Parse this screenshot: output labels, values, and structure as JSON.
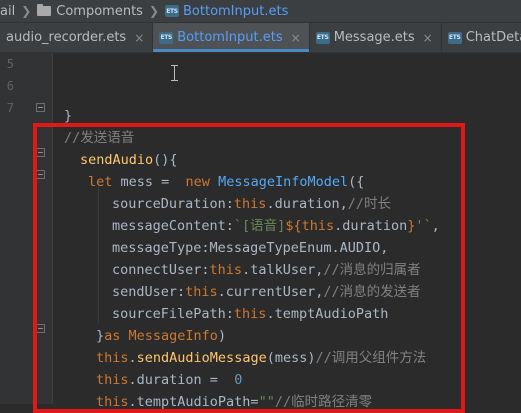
{
  "breadcrumb": {
    "items": [
      {
        "label": "ail",
        "kind": "folder",
        "active": false
      },
      {
        "label": "Compoments",
        "kind": "folder",
        "active": false
      },
      {
        "label": "BottomInput.ets",
        "kind": "ets-file",
        "active": true
      }
    ]
  },
  "tabs": [
    {
      "label": "audio_recorder.ets",
      "icon": "none",
      "active": false
    },
    {
      "label": "BottomInput.ets",
      "icon": "ets-file-icon",
      "active": true
    },
    {
      "label": "Message.ets",
      "icon": "ets-file-icon",
      "active": false
    },
    {
      "label": "ChatDetail.ets",
      "icon": "ets-file-icon",
      "active": false
    }
  ],
  "tab_close_glyph": "×",
  "ets_icon_text": "ETS",
  "gutter": {
    "line_numbers": [
      "5",
      "6",
      "7"
    ]
  },
  "code_lines": [
    {
      "indent": 0,
      "tokens": []
    },
    {
      "indent": 0,
      "tokens": []
    },
    {
      "indent": 64,
      "tokens": [
        {
          "t": "}",
          "c": "plain"
        }
      ]
    },
    {
      "indent": 64,
      "tokens": [
        {
          "t": "//发送语音",
          "c": "cmt"
        }
      ]
    },
    {
      "indent": 80,
      "tokens": [
        {
          "t": "sendAudio",
          "c": "fn"
        },
        {
          "t": "(){",
          "c": "plain"
        }
      ]
    },
    {
      "indent": 88,
      "tokens": [
        {
          "t": "let ",
          "c": "kw"
        },
        {
          "t": "mess =  ",
          "c": "plain"
        },
        {
          "t": "new ",
          "c": "kw"
        },
        {
          "t": "MessageInfoModel",
          "c": "cls"
        },
        {
          "t": "({",
          "c": "plain"
        }
      ]
    },
    {
      "indent": 112,
      "tokens": [
        {
          "t": "sourceDuration:",
          "c": "plain"
        },
        {
          "t": "this",
          "c": "kw"
        },
        {
          "t": ".duration,",
          "c": "plain"
        },
        {
          "t": "//时长",
          "c": "cmt"
        }
      ]
    },
    {
      "indent": 112,
      "tokens": [
        {
          "t": "messageContent:",
          "c": "plain"
        },
        {
          "t": "`[语音]",
          "c": "str"
        },
        {
          "t": "${",
          "c": "kw"
        },
        {
          "t": "this",
          "c": "kw"
        },
        {
          "t": ".duration",
          "c": "plain"
        },
        {
          "t": "}",
          "c": "kw"
        },
        {
          "t": "'`",
          "c": "str"
        },
        {
          "t": ",",
          "c": "plain"
        }
      ]
    },
    {
      "indent": 112,
      "tokens": [
        {
          "t": "messageType:MessageTypeEnum.AUDIO,",
          "c": "plain"
        }
      ]
    },
    {
      "indent": 112,
      "tokens": [
        {
          "t": "connectUser:",
          "c": "plain"
        },
        {
          "t": "this",
          "c": "kw"
        },
        {
          "t": ".talkUser,",
          "c": "plain"
        },
        {
          "t": "//消息的归属者",
          "c": "cmt"
        }
      ]
    },
    {
      "indent": 112,
      "tokens": [
        {
          "t": "sendUser:",
          "c": "plain"
        },
        {
          "t": "this",
          "c": "kw"
        },
        {
          "t": ".currentUser,",
          "c": "plain"
        },
        {
          "t": "//消息的发送者",
          "c": "cmt"
        }
      ]
    },
    {
      "indent": 112,
      "tokens": [
        {
          "t": "sourceFilePath:",
          "c": "plain"
        },
        {
          "t": "this",
          "c": "kw"
        },
        {
          "t": ".temptAudioPath",
          "c": "plain"
        }
      ]
    },
    {
      "indent": 96,
      "tokens": [
        {
          "t": "}",
          "c": "plain"
        },
        {
          "t": "as ",
          "c": "kw"
        },
        {
          "t": "MessageInfo",
          "c": "kw"
        },
        {
          "t": ")",
          "c": "plain"
        }
      ]
    },
    {
      "indent": 96,
      "tokens": [
        {
          "t": "this",
          "c": "kw"
        },
        {
          "t": ".",
          "c": "plain"
        },
        {
          "t": "sendAudioMessage",
          "c": "fn"
        },
        {
          "t": "(mess)",
          "c": "plain"
        },
        {
          "t": "//调用父组件方法",
          "c": "cmt"
        }
      ]
    },
    {
      "indent": 96,
      "tokens": [
        {
          "t": "this",
          "c": "kw"
        },
        {
          "t": ".duration =  ",
          "c": "plain"
        },
        {
          "t": "0",
          "c": "num"
        }
      ]
    },
    {
      "indent": 96,
      "tokens": [
        {
          "t": "this",
          "c": "kw"
        },
        {
          "t": ".temptAudioPath=",
          "c": "plain"
        },
        {
          "t": "\"\"",
          "c": "str"
        },
        {
          "t": "//临时路径清零",
          "c": "cmt"
        }
      ]
    }
  ],
  "theme": {
    "keyword": "#cc7832",
    "function": "#ffc66d",
    "class": "#56a8f5",
    "string": "#6a8759",
    "number": "#6897bb",
    "comment": "#808080",
    "plain": "#a9b7c6",
    "highlight_border": "#e11818",
    "active_tab_text": "#589df6"
  }
}
